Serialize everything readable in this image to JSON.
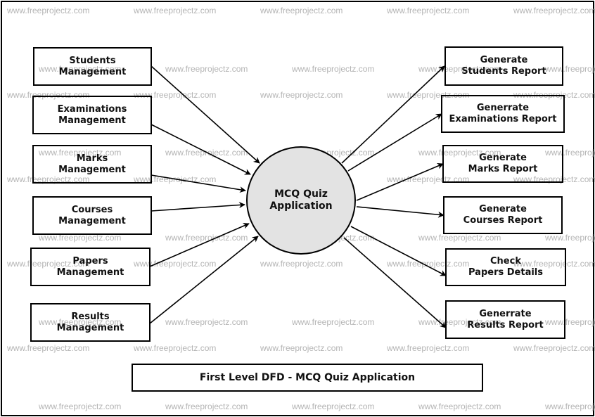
{
  "diagram": {
    "title": "First Level DFD - MCQ Quiz Application",
    "central_process": "MCQ Quiz\nApplication",
    "inputs": [
      {
        "label": "Students\nManagement"
      },
      {
        "label": "Examinations\nManagement"
      },
      {
        "label": "Marks\nManagement"
      },
      {
        "label": "Courses\nManagement"
      },
      {
        "label": "Papers\nManagement"
      },
      {
        "label": "Results\nManagement"
      }
    ],
    "outputs": [
      {
        "label": "Generate\nStudents Report"
      },
      {
        "label": "Generrate\nExaminations Report"
      },
      {
        "label": "Generate\nMarks Report"
      },
      {
        "label": "Generate\nCourses Report"
      },
      {
        "label": "Check\nPapers Details"
      },
      {
        "label": "Generrate\nResults Report"
      }
    ],
    "watermark": "www.freeprojectz.com",
    "colors": {
      "process_fill": "#e3e3e3",
      "stroke": "#000000",
      "watermark": "#b4b4b4"
    }
  }
}
